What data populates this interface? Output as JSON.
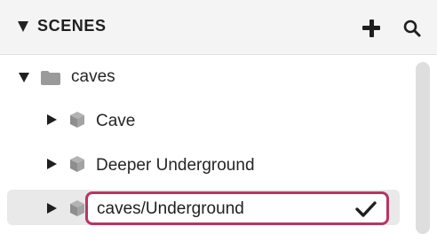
{
  "header": {
    "title": "SCENES",
    "add_icon": "plus-icon",
    "search_icon": "search-icon"
  },
  "tree": {
    "folder": {
      "label": "caves",
      "icon": "folder-icon",
      "expanded": true
    },
    "scenes": [
      {
        "label": "Cave",
        "icon": "cube-icon"
      },
      {
        "label": "Deeper Underground",
        "icon": "cube-icon"
      }
    ],
    "editing": {
      "value": "caves/Underground",
      "icon": "cube-icon",
      "confirm_icon": "checkmark-icon"
    }
  },
  "colors": {
    "accent": "#b7365f",
    "header_bg": "#f4f4f4",
    "selected_row": "#e9e9e9",
    "icon_gray": "#9a9a9a"
  }
}
